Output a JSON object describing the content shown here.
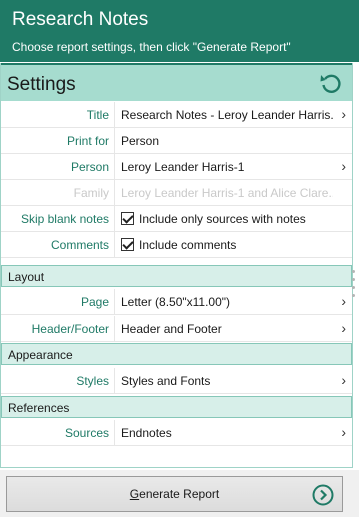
{
  "header": {
    "title": "Research Notes",
    "subtitle": "Choose report settings, then click \"Generate Report\""
  },
  "settings": {
    "heading": "Settings",
    "reset_icon": "reset-icon",
    "rows": {
      "title": {
        "label": "Title",
        "value": "Research Notes - Leroy Leander Harris..."
      },
      "print_for": {
        "label": "Print for",
        "value": "Person"
      },
      "person": {
        "label": "Person",
        "value": "Leroy Leander Harris-1"
      },
      "family": {
        "label": "Family",
        "value": "Leroy Leander Harris-1 and Alice Clare..."
      },
      "skip_blank": {
        "label": "Skip blank notes",
        "value": "Include only sources with notes",
        "checked": true
      },
      "comments": {
        "label": "Comments",
        "value": "Include comments",
        "checked": true
      }
    }
  },
  "layout": {
    "heading": "Layout",
    "page": {
      "label": "Page",
      "value": "Letter (8.50\"x11.00\")"
    },
    "header_footer": {
      "label": "Header/Footer",
      "value": "Header and Footer"
    }
  },
  "appearance": {
    "heading": "Appearance",
    "styles": {
      "label": "Styles",
      "value": "Styles and Fonts"
    }
  },
  "references": {
    "heading": "References",
    "sources": {
      "label": "Sources",
      "value": "Endnotes"
    }
  },
  "footer": {
    "generate_label": "Generate Report"
  },
  "colors": {
    "header_bg": "#1f7a66",
    "settings_bg": "#a6dccf",
    "label_text": "#1f7a66",
    "section_bg": "#d7efe9"
  }
}
